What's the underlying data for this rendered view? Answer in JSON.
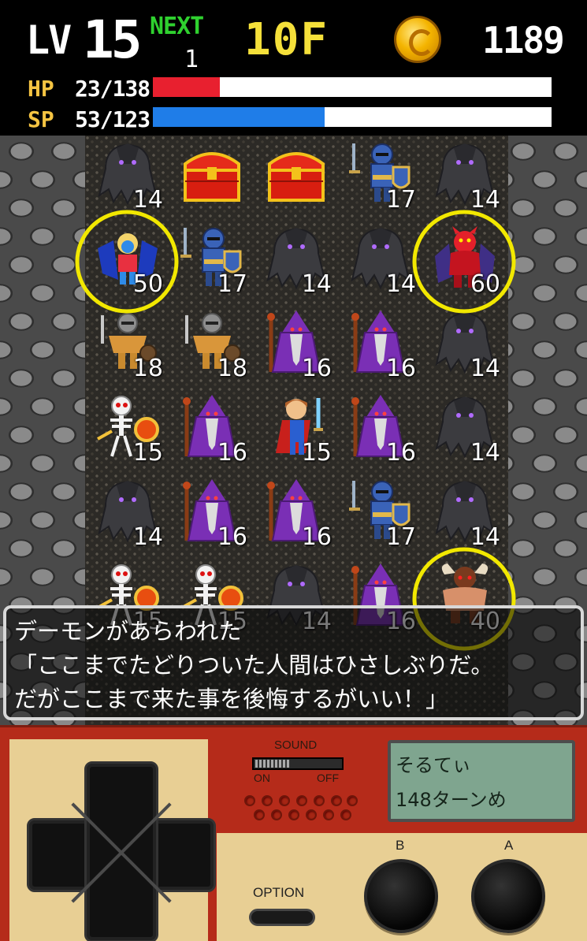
{
  "hud": {
    "lv_label": "LV",
    "lv_value": "15",
    "next_label": "NEXT",
    "next_value": "1",
    "floor": "10F",
    "gold": "1189",
    "hp_label": "HP",
    "hp_value": "23/138",
    "hp_fraction": 0.167,
    "sp_label": "SP",
    "sp_value": "53/123",
    "sp_fraction": 0.431,
    "colors": {
      "hp": "#e8202f",
      "sp": "#1f7de8",
      "floor": "#f5e03a",
      "next": "#2fd12f"
    }
  },
  "board": {
    "rows": [
      [
        {
          "sprite": "ghost",
          "num": "14"
        },
        {
          "sprite": "chest",
          "num": ""
        },
        {
          "sprite": "chest",
          "num": ""
        },
        {
          "sprite": "knight",
          "num": "17"
        },
        {
          "sprite": "ghost",
          "num": "14"
        }
      ],
      [
        {
          "sprite": "harpy",
          "num": "50",
          "highlight": true
        },
        {
          "sprite": "knight",
          "num": "17"
        },
        {
          "sprite": "ghost",
          "num": "14"
        },
        {
          "sprite": "ghost",
          "num": "14"
        },
        {
          "sprite": "red-demon",
          "num": "60",
          "highlight": true
        }
      ],
      [
        {
          "sprite": "warrior",
          "num": "18"
        },
        {
          "sprite": "warrior",
          "num": "18"
        },
        {
          "sprite": "wizard",
          "num": "16"
        },
        {
          "sprite": "wizard",
          "num": "16"
        },
        {
          "sprite": "ghost",
          "num": "14"
        }
      ],
      [
        {
          "sprite": "skeleton",
          "num": "15"
        },
        {
          "sprite": "wizard",
          "num": "16"
        },
        {
          "sprite": "hero",
          "num": "15"
        },
        {
          "sprite": "wizard",
          "num": "16"
        },
        {
          "sprite": "ghost",
          "num": "14"
        }
      ],
      [
        {
          "sprite": "ghost",
          "num": "14"
        },
        {
          "sprite": "wizard",
          "num": "16"
        },
        {
          "sprite": "wizard",
          "num": "16"
        },
        {
          "sprite": "knight",
          "num": "17"
        },
        {
          "sprite": "ghost",
          "num": "14"
        }
      ],
      [
        {
          "sprite": "skeleton",
          "num": "15"
        },
        {
          "sprite": "skeleton",
          "num": "15"
        },
        {
          "sprite": "ghost",
          "num": "14"
        },
        {
          "sprite": "wizard",
          "num": "16"
        },
        {
          "sprite": "minotaur",
          "num": "40",
          "highlight": true
        }
      ]
    ],
    "highlight_color": "#f2e800"
  },
  "dialog": {
    "lines": [
      "デーモンがあらわれた",
      "「ここまでたどりついた人間はひさしぶりだ。",
      "だがここまで来た事を後悔するがいい！」"
    ]
  },
  "controller": {
    "sound_label": "SOUND",
    "on_label": "ON",
    "off_label": "OFF",
    "screen_line1": "そるてぃ",
    "screen_line2": "148ターンめ",
    "option_label": "OPTION",
    "b_label": "B",
    "a_label": "A"
  }
}
